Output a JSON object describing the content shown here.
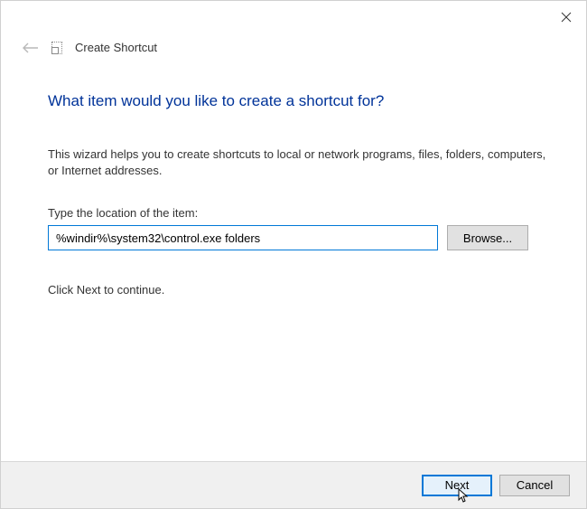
{
  "header": {
    "title": "Create Shortcut"
  },
  "main": {
    "heading": "What item would you like to create a shortcut for?",
    "description": "This wizard helps you to create shortcuts to local or network programs, files, folders, computers, or Internet addresses.",
    "location_label": "Type the location of the item:",
    "location_value": "%windir%\\system32\\control.exe folders",
    "browse_label": "Browse...",
    "continue_text": "Click Next to continue."
  },
  "footer": {
    "next_label": "Next",
    "cancel_label": "Cancel"
  }
}
